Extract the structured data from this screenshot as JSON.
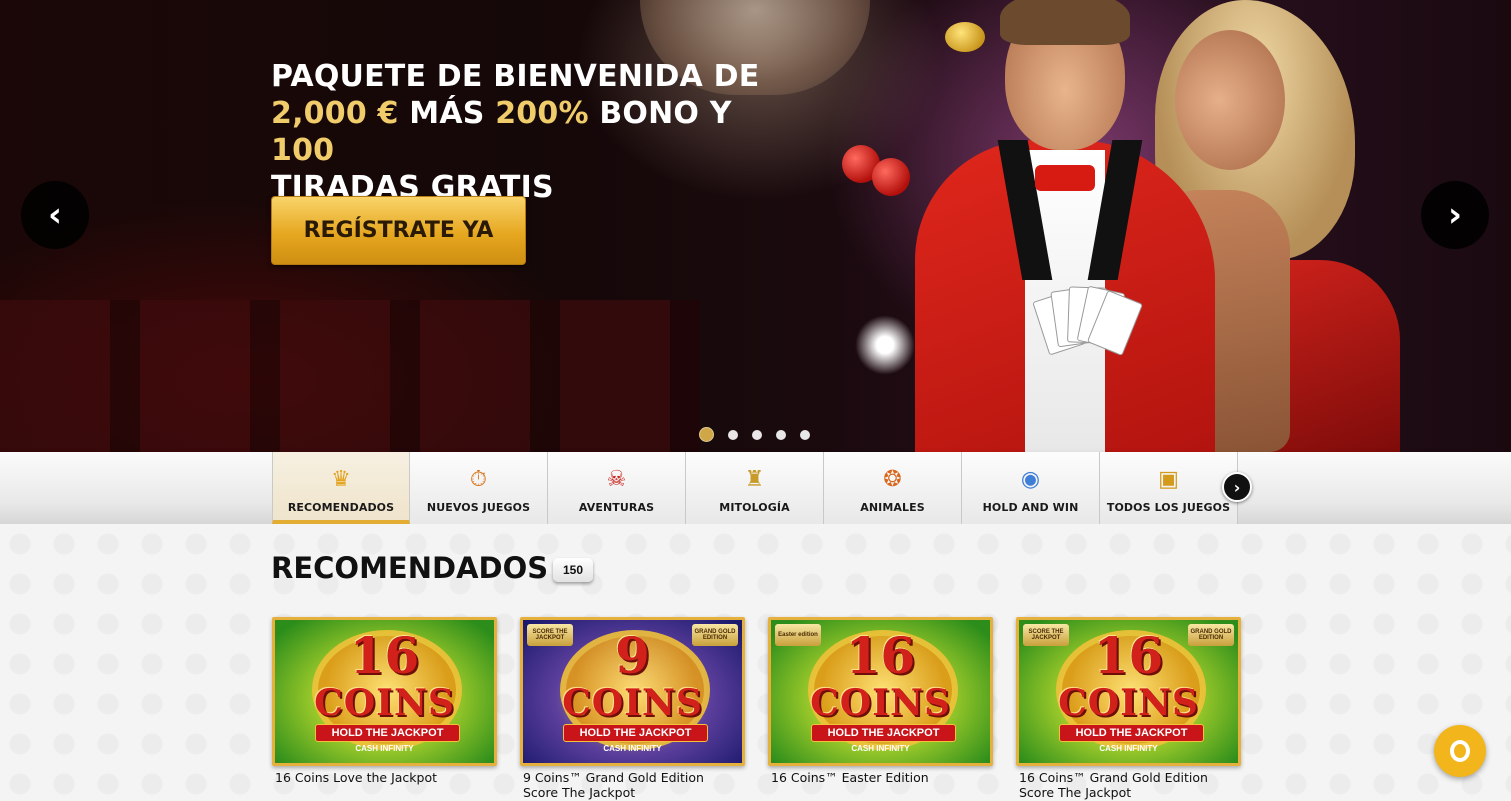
{
  "hero": {
    "headline_line1": "PAQUETE DE BIENVENIDA DE",
    "headline_amount": "2,000 €",
    "headline_plus": "MÁS",
    "headline_bonus": "200%",
    "headline_bonus_word": "BONO Y",
    "headline_spins": "100",
    "headline_line3": "TIRADAS GRATIS",
    "cta_label": "REGÍSTRATE YA",
    "prev_arrow": "‹",
    "next_arrow": "›",
    "slides_count": 5,
    "active_slide": 1
  },
  "categories": {
    "tabs": [
      {
        "label": "RECOMENDADOS",
        "icon": "crown-icon",
        "glyph": "♛",
        "color": "#e2a21c",
        "active": true
      },
      {
        "label": "NUEVOS JUEGOS",
        "icon": "stopwatch-icon",
        "glyph": "⏱",
        "color": "#d9741a",
        "active": false
      },
      {
        "label": "AVENTURAS",
        "icon": "pirate-skull-icon",
        "glyph": "☠",
        "color": "#c8231b",
        "active": false
      },
      {
        "label": "MITOLOGÍA",
        "icon": "pharaoh-icon",
        "glyph": "♜",
        "color": "#c79a2a",
        "active": false
      },
      {
        "label": "ANIMALES",
        "icon": "lion-icon",
        "glyph": "❂",
        "color": "#d8661b",
        "active": false
      },
      {
        "label": "HOLD AND WIN",
        "icon": "swirl-orb-icon",
        "glyph": "◉",
        "color": "#3f7fd6",
        "active": false
      },
      {
        "label": "TODOS LOS JUEGOS",
        "icon": "treasure-chest-icon",
        "glyph": "▣",
        "color": "#d49a1c",
        "active": false
      }
    ],
    "next_arrow": "›"
  },
  "section": {
    "title": "RECOMENDADOS",
    "count": "150"
  },
  "games": [
    {
      "name_line1": "16 Coins Love the Jackpot",
      "name_line2": "",
      "thumb_number": "16",
      "thumb_word": "COINS",
      "thumb_ribbon": "HOLD THE JACKPOT",
      "thumb_sub": "CASH INFINITY",
      "theme": "green"
    },
    {
      "name_line1": "9 Coins™ Grand Gold Edition",
      "name_line2": "Score The Jackpot",
      "thumb_number": "9",
      "thumb_word": "COINS",
      "thumb_ribbon": "HOLD THE JACKPOT",
      "thumb_sub": "CASH INFINITY",
      "theme": "blue",
      "badge_right": "GRAND GOLD EDITION",
      "badge_left": "SCORE THE JACKPOT"
    },
    {
      "name_line1": "16 Coins™ Easter Edition",
      "name_line2": "",
      "thumb_number": "16",
      "thumb_word": "COINS",
      "thumb_ribbon": "HOLD THE JACKPOT",
      "thumb_sub": "CASH INFINITY",
      "theme": "green",
      "badge_left": "Easter edition"
    },
    {
      "name_line1": "16 Coins™ Grand Gold Edition",
      "name_line2": "Score The Jackpot",
      "thumb_number": "16",
      "thumb_word": "COINS",
      "thumb_ribbon": "HOLD THE JACKPOT",
      "thumb_sub": "CASH INFINITY",
      "theme": "green",
      "badge_right": "GRAND GOLD EDITION",
      "badge_left": "SCORE THE JACKPOT"
    }
  ],
  "colors": {
    "accent_gold": "#e3ac33",
    "headline_gold": "#f1cc6a",
    "chat_button": "#f2b51b"
  }
}
